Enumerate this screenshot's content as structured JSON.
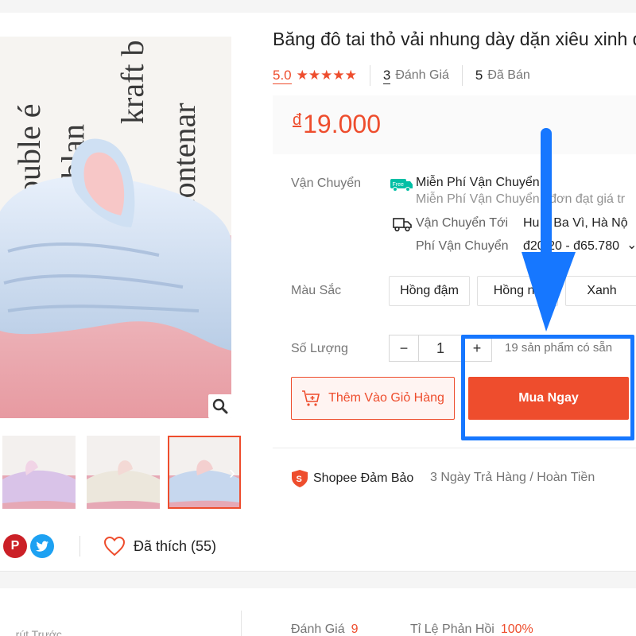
{
  "product": {
    "title": "Băng đô tai thỏ vải nhung dày dặn xiêu xinh d",
    "rating": "5.0",
    "stars": "★★★★★",
    "review_count": "3",
    "review_label": "Đánh Giá",
    "sold_count": "5",
    "sold_label": "Đã Bán",
    "currency": "đ",
    "price": "19.000"
  },
  "shipping": {
    "label": "Vận Chuyển",
    "free_badge": "Free",
    "free_title": "Miễn Phí Vận Chuyển",
    "free_desc": "Miễn Phí Vận Chuyển  i đơn đạt giá tr",
    "to_label": "Vận Chuyển Tới",
    "to_value": "Hu   n Ba Vì, Hà Nộ",
    "fee_label": "Phí Vận Chuyển",
    "fee_value": "đ20  20 - đ65.780"
  },
  "color": {
    "label": "Màu Sắc",
    "options": [
      "Hồng đậm",
      "Hồng nh",
      "Xanh"
    ]
  },
  "quantity": {
    "label": "Số Lượng",
    "minus": "−",
    "value": "1",
    "plus": "+",
    "stock": "19 sản phẩm có sẵn"
  },
  "actions": {
    "add_to_cart": "Thêm Vào Giỏ Hàng",
    "buy_now": "Mua Ngay"
  },
  "guarantee": {
    "title": "Shopee Đảm Bảo",
    "detail": "3 Ngày Trả Hàng / Hoàn Tiền"
  },
  "social": {
    "liked": "Đã thích (55)"
  },
  "shop": {
    "left_text": "...rút Trước",
    "rating_label": "Đánh Giá",
    "rating_value": "9",
    "response_label": "Tỉ Lệ Phản Hồi",
    "response_value": "100%"
  },
  "colors": {
    "accent": "#ee4d2d",
    "annotation": "#1677ff"
  },
  "icons": {
    "zoom": "magnifier-icon",
    "free_ship": "free-shipping-icon",
    "truck": "truck-icon",
    "cart": "cart-plus-icon",
    "shield": "shopee-shield-icon",
    "heart": "heart-icon",
    "pinterest": "pinterest-icon",
    "twitter": "twitter-icon",
    "chevron": "chevron-right-icon"
  }
}
